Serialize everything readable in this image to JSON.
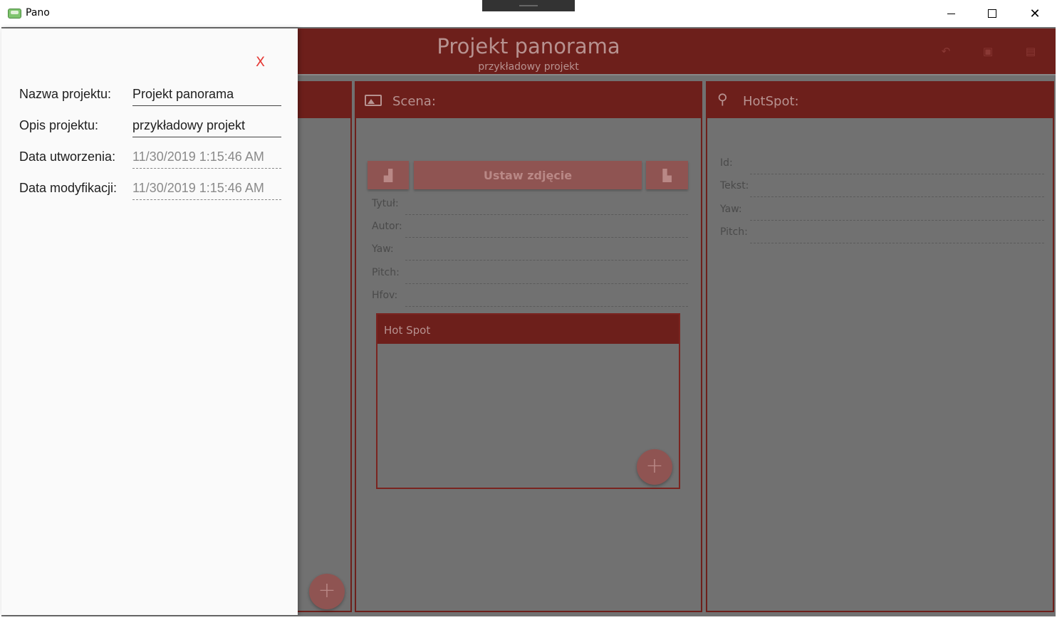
{
  "window": {
    "title": "Pano",
    "icon": "app-360-icon",
    "controls": [
      "minimize-icon",
      "maximize-icon",
      "close-icon"
    ],
    "close_glyph": "✕"
  },
  "header": {
    "title": "Projekt panorama",
    "subtitle": "przykładowy projekt",
    "icons": [
      "undo-icon",
      "save-icon",
      "export-icon"
    ]
  },
  "scene_panel": {
    "title": "Scena:",
    "icon": "image-icon",
    "set_photo_label": "Ustaw zdjęcie",
    "fields": [
      "Tytuł:",
      "Autor:",
      "Yaw:",
      "Pitch:",
      "Hfov:"
    ],
    "hotspot_list_title": "Hot Spot",
    "add_label": "+"
  },
  "hotspot_panel": {
    "title": "HotSpot:",
    "icon": "map-pin-icon",
    "fields": [
      "Id:",
      "Tekst:",
      "Yaw:",
      "Pitch:"
    ]
  },
  "left_panel": {
    "add_label": "+"
  },
  "project_drawer": {
    "close_label": "X",
    "rows": [
      {
        "label": "Nazwa projektu:",
        "value": "Projekt panorama",
        "editable": true
      },
      {
        "label": "Opis projektu:",
        "value": "przykładowy projekt",
        "editable": true
      },
      {
        "label": "Data utworzenia:",
        "value": "11/30/2019 1:15:46 AM",
        "editable": false
      },
      {
        "label": "Data modyfikacji:",
        "value": "11/30/2019 1:15:46 AM",
        "editable": false
      }
    ]
  },
  "colors": {
    "accent": "#6d1f1b",
    "overlay": "#717171",
    "close_x": "#e53935"
  }
}
